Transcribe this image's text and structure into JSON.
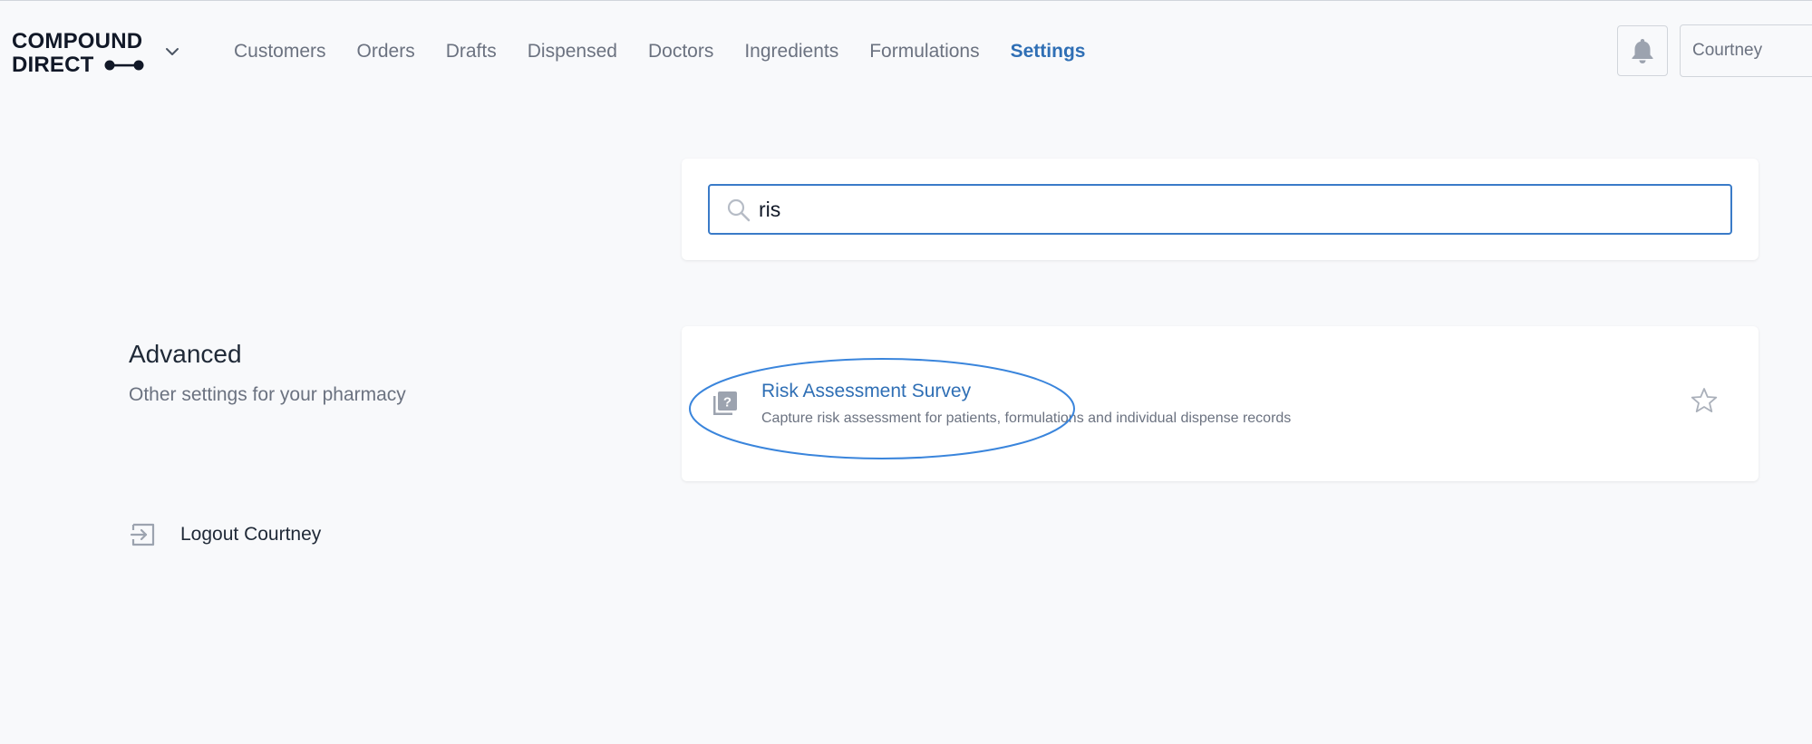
{
  "brand": {
    "line1": "COMPOUND",
    "line2": "DIRECT"
  },
  "nav": {
    "items": [
      {
        "label": "Customers",
        "active": false
      },
      {
        "label": "Orders",
        "active": false
      },
      {
        "label": "Drafts",
        "active": false
      },
      {
        "label": "Dispensed",
        "active": false
      },
      {
        "label": "Doctors",
        "active": false
      },
      {
        "label": "Ingredients",
        "active": false
      },
      {
        "label": "Formulations",
        "active": false
      },
      {
        "label": "Settings",
        "active": true
      }
    ]
  },
  "user": {
    "name": "Courtney"
  },
  "search": {
    "value": "ris"
  },
  "section": {
    "title": "Advanced",
    "subtitle": "Other settings for your pharmacy"
  },
  "result": {
    "title": "Risk Assessment Survey",
    "description": "Capture risk assessment for patients, formulations and individual dispense records",
    "icon": "question-book-icon",
    "favorited": false
  },
  "logout": {
    "label": "Logout Courtney"
  },
  "colors": {
    "accent": "#2f6fb5",
    "focus_border": "#3a7bc8",
    "muted_text": "#6b7280",
    "background": "#f8f9fb",
    "annotation": "#3a85dc"
  }
}
